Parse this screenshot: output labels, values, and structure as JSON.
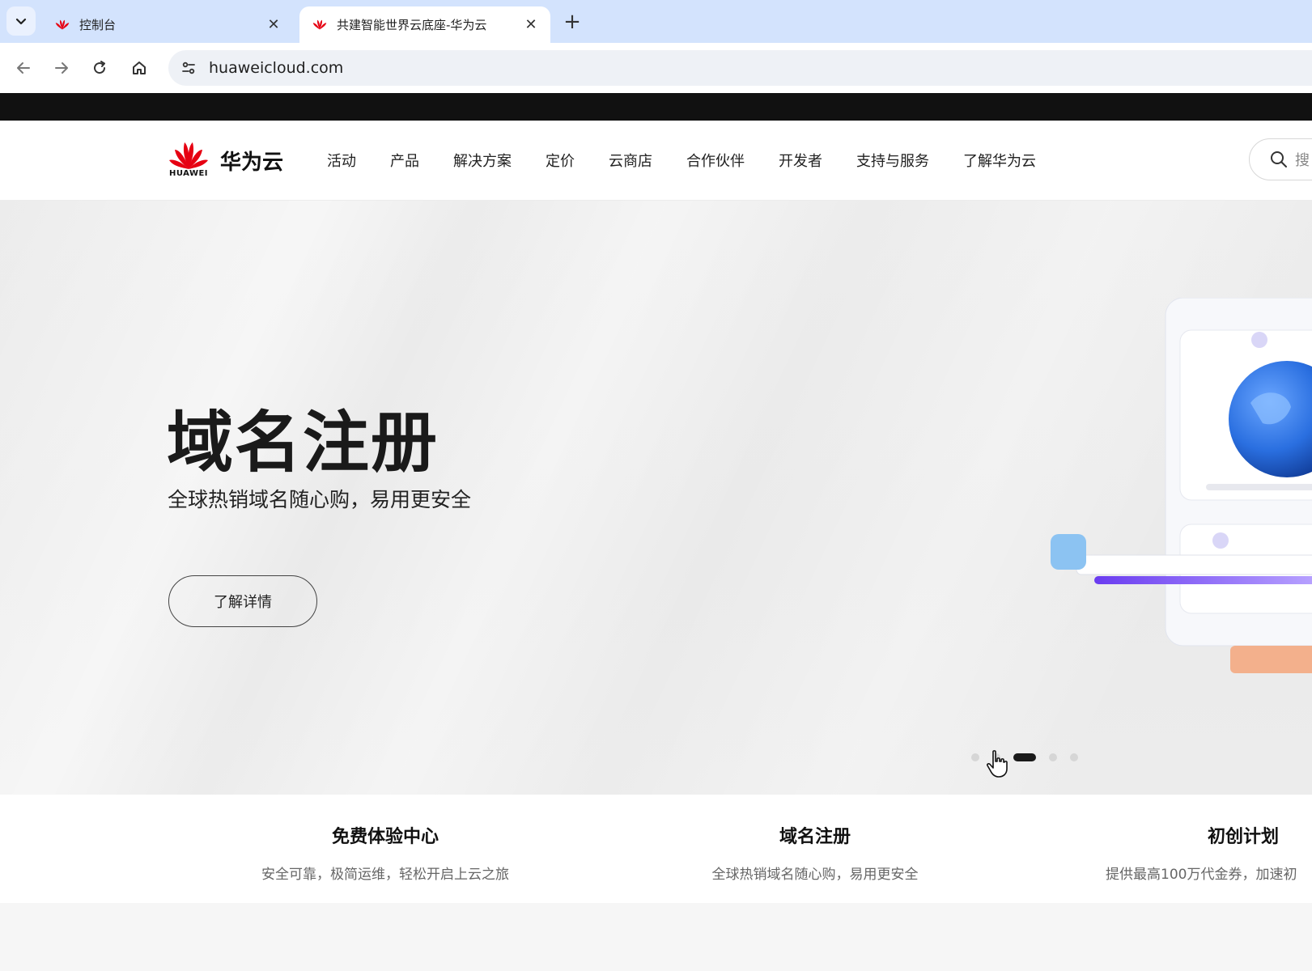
{
  "browser": {
    "tabs": [
      {
        "title": "控制台",
        "active": false
      },
      {
        "title": "共建智能世界云底座-华为云",
        "active": true
      }
    ],
    "tab_close_glyph": "✕",
    "new_tab_glyph": "+",
    "url": "huaweicloud.com"
  },
  "site": {
    "brand_name": "华为云",
    "brand_wordmark": "HUAWEI",
    "brand_color": "#e60012",
    "nav": [
      "活动",
      "产品",
      "解决方案",
      "定价",
      "云商店",
      "合作伙伴",
      "开发者",
      "支持与服务",
      "了解华为云"
    ],
    "search_placeholder": "搜"
  },
  "hero": {
    "title": "域名注册",
    "subtitle": "全球热销域名随心购，易用更安全",
    "cta_label": "了解详情",
    "carousel": {
      "count": 5,
      "active_index": 2
    }
  },
  "features": [
    {
      "title": "免费体验中心",
      "desc": "安全可靠，极简运维，轻松开启上云之旅"
    },
    {
      "title": "域名注册",
      "desc": "全球热销域名随心购，易用更安全"
    },
    {
      "title": "初创计划",
      "desc": "提供最高100万代金券，加速初"
    }
  ]
}
